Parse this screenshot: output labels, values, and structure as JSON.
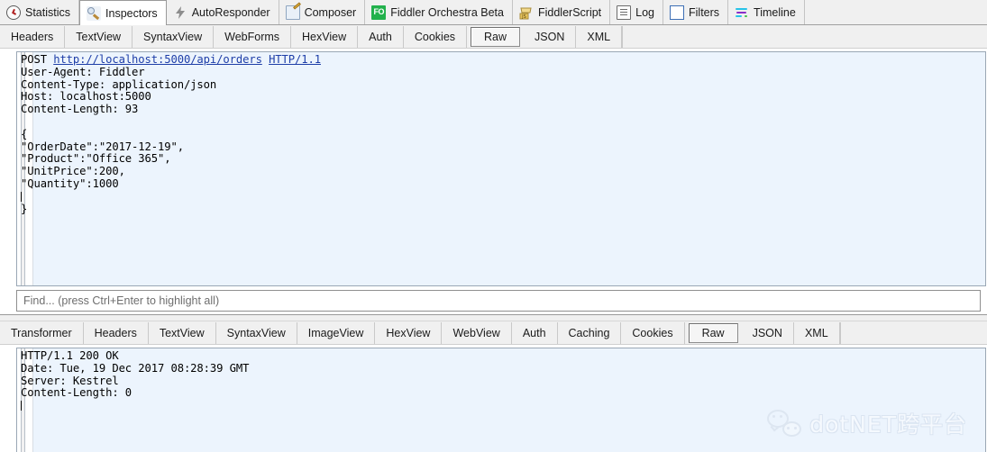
{
  "app": {
    "name": "Fiddler",
    "accent_green": "#22b14c",
    "link_color": "#1e3ea8",
    "panel_bg": "#ecf4fd"
  },
  "main_tabs": [
    {
      "label": "Statistics",
      "icon": "clock-icon",
      "active": false
    },
    {
      "label": "Inspectors",
      "icon": "magnifier-icon",
      "active": true
    },
    {
      "label": "AutoResponder",
      "icon": "lightning-bolt-icon",
      "active": false
    },
    {
      "label": "Composer",
      "icon": "notepad-pencil-icon",
      "active": false
    },
    {
      "label": "Fiddler Orchestra Beta",
      "icon": "fo-badge-icon",
      "active": false
    },
    {
      "label": "FiddlerScript",
      "icon": "js-script-icon",
      "active": false
    },
    {
      "label": "Log",
      "icon": "log-lines-icon",
      "active": false
    },
    {
      "label": "Filters",
      "icon": "filter-box-icon",
      "active": false
    },
    {
      "label": "Timeline",
      "icon": "timeline-bars-icon",
      "active": false
    }
  ],
  "request": {
    "tabs": [
      {
        "label": "Headers",
        "selected": false
      },
      {
        "label": "TextView",
        "selected": false
      },
      {
        "label": "SyntaxView",
        "selected": false
      },
      {
        "label": "WebForms",
        "selected": false
      },
      {
        "label": "HexView",
        "selected": false
      },
      {
        "label": "Auth",
        "selected": false
      },
      {
        "label": "Cookies",
        "selected": false
      },
      {
        "label": "Raw",
        "selected": true
      },
      {
        "label": "JSON",
        "selected": false
      },
      {
        "label": "XML",
        "selected": false
      }
    ],
    "request_line": {
      "method": "POST",
      "url": "http://localhost:5000/api/orders",
      "version": "HTTP/1.1"
    },
    "headers": [
      "User-Agent: Fiddler",
      "Content-Type: application/json",
      "Host: localhost:5000",
      "Content-Length: 93"
    ],
    "body_lines": [
      "{",
      "\"OrderDate\":\"2017-12-19\",",
      "\"Product\":\"Office 365\",",
      "\"UnitPrice\":200,",
      "\"Quantity\":1000"
    ],
    "body_close": "}"
  },
  "find": {
    "placeholder": "Find... (press Ctrl+Enter to highlight all)",
    "value": ""
  },
  "response": {
    "tabs": [
      {
        "label": "Transformer",
        "selected": false
      },
      {
        "label": "Headers",
        "selected": false
      },
      {
        "label": "TextView",
        "selected": false
      },
      {
        "label": "SyntaxView",
        "selected": false
      },
      {
        "label": "ImageView",
        "selected": false
      },
      {
        "label": "HexView",
        "selected": false
      },
      {
        "label": "WebView",
        "selected": false
      },
      {
        "label": "Auth",
        "selected": false
      },
      {
        "label": "Caching",
        "selected": false
      },
      {
        "label": "Cookies",
        "selected": false
      },
      {
        "label": "Raw",
        "selected": true
      },
      {
        "label": "JSON",
        "selected": false
      },
      {
        "label": "XML",
        "selected": false
      }
    ],
    "status_line": "HTTP/1.1 200 OK",
    "headers": [
      "Date: Tue, 19 Dec 2017 08:28:39 GMT",
      "Server: Kestrel",
      "Content-Length: 0"
    ]
  },
  "watermark": {
    "text": "dotNET跨平台",
    "icon": "wechat-logo-icon"
  }
}
